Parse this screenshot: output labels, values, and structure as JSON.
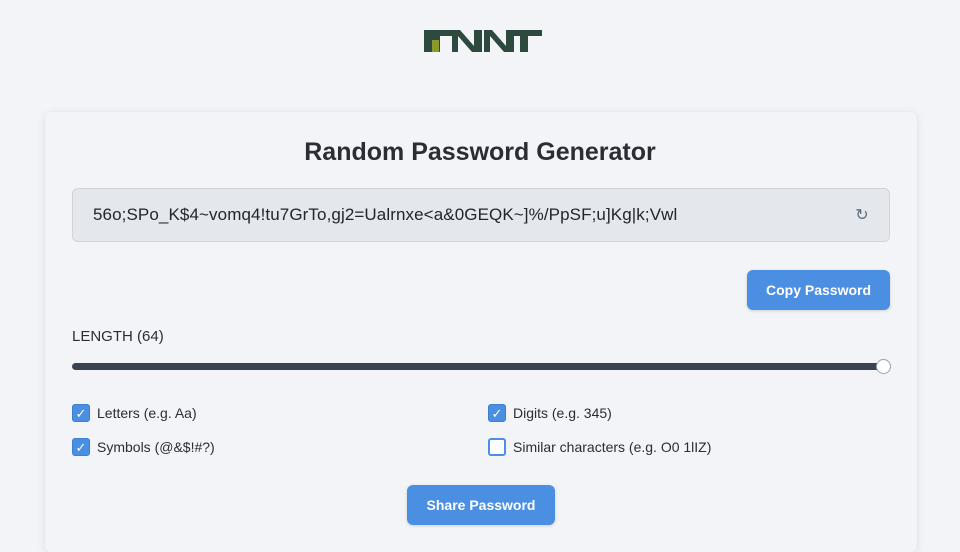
{
  "header": {
    "logo_name": "MNT logo",
    "logo_colors": {
      "dark": "#2e4a3e",
      "accent": "#8a9a2a"
    }
  },
  "generator": {
    "title": "Random Password Generator",
    "password": "56o;SPo_K$4~vomq4!tu7GrTo,gj2=Ualrnxe<a&0GEQK~]%/PpSF;u]Kg|k;Vwl",
    "refresh_icon": "↻",
    "copy_label": "Copy Password",
    "length_label": "LENGTH (64)",
    "length_value": 64,
    "options": {
      "letters": {
        "label": "Letters (e.g. Aa)",
        "checked": true
      },
      "symbols": {
        "label": "Symbols (@&$!#?)",
        "checked": true
      },
      "digits": {
        "label": "Digits (e.g. 345)",
        "checked": true
      },
      "similar": {
        "label": "Similar characters (e.g. O0 1lIZ)",
        "checked": false
      }
    },
    "check_glyph": "✓",
    "share_label": "Share Password"
  },
  "colors": {
    "accent": "#4a8fe2",
    "background": "#f2f4f7",
    "slider": "#3a4352"
  }
}
